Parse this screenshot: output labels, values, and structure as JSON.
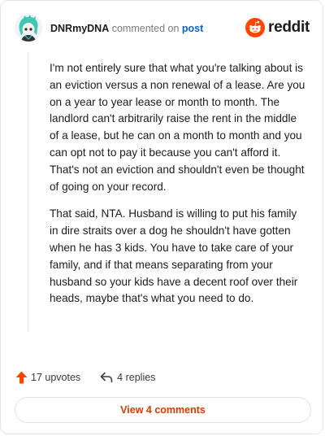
{
  "header": {
    "username": "DNRmyDNA",
    "commented_text": "commented on",
    "post_link": "post",
    "brand": "reddit"
  },
  "comment": {
    "paragraphs": [
      "I'm not entirely sure that what you're talking about is an eviction versus a non renewal of a lease. Are you on a year to year lease or month to month. The landlord can't arbitrarily raise the rent in the middle of a lease, but he can on a month to month and you can opt not to pay it because you can't afford it. That's not an eviction and shouldn't even be thought of going on your record.",
      "That said, NTA. Husband is willing to put his family in dire straits over a dog he shouldn't have gotten when he has 3 kids. You have to take care of your family, and if that means separating from your husband so your kids have a decent roof over their heads, maybe that's what you need to do."
    ]
  },
  "actions": {
    "upvotes": "17 upvotes",
    "replies": "4 replies"
  },
  "footer": {
    "view_comments": "View 4 comments"
  },
  "colors": {
    "accent": "#ff4500",
    "link": "#0b61c7",
    "view_button_text": "#d93a00"
  },
  "icons": {
    "avatar": "avatar",
    "brand_logo": "reddit-logo-icon",
    "upvote": "upvote-arrow-icon",
    "reply": "reply-arrow-icon"
  }
}
